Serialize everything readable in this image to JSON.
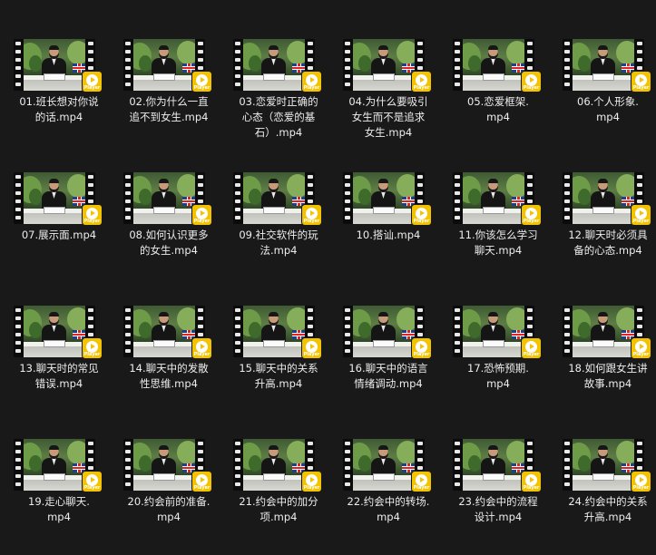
{
  "view": "file-grid",
  "thumbnail": {
    "type": "video-file",
    "badge_icon": "player-app-icon",
    "badge_text": "Player",
    "badge_color": "#f3c300"
  },
  "background_color": "#191919",
  "files": [
    {
      "name": "01.班长想对你说的话.mp4",
      "lines": [
        "01.班长想对你说",
        "的话.mp4"
      ]
    },
    {
      "name": "02.你为什么一直追不到女生.mp4",
      "lines": [
        "02.你为什么一直",
        "追不到女生.mp4"
      ]
    },
    {
      "name": "03.恋爱时正确的心态（恋爱的基石）.mp4",
      "lines": [
        "03.恋爱时正确的",
        "心态（恋爱的基",
        "石）.mp4"
      ]
    },
    {
      "name": "04.为什么要吸引女生而不是追求女生.mp4",
      "lines": [
        "04.为什么要吸引",
        "女生而不是追求",
        "女生.mp4"
      ]
    },
    {
      "name": "05.恋爱框架.mp4",
      "lines": [
        "05.恋爱框架.",
        "mp4"
      ]
    },
    {
      "name": "06.个人形象.mp4",
      "lines": [
        "06.个人形象.",
        "mp4"
      ]
    },
    {
      "name": "07.展示面.mp4",
      "lines": [
        "07.展示面.mp4"
      ]
    },
    {
      "name": "08.如何认识更多的女生.mp4",
      "lines": [
        "08.如何认识更多",
        "的女生.mp4"
      ]
    },
    {
      "name": "09.社交软件的玩法.mp4",
      "lines": [
        "09.社交软件的玩",
        "法.mp4"
      ]
    },
    {
      "name": "10.搭讪.mp4",
      "lines": [
        "10.搭讪.mp4"
      ]
    },
    {
      "name": "11.你该怎么学习聊天.mp4",
      "lines": [
        "11.你该怎么学习",
        "聊天.mp4"
      ]
    },
    {
      "name": "12.聊天时必须具备的心态.mp4",
      "lines": [
        "12.聊天时必须具",
        "备的心态.mp4"
      ]
    },
    {
      "name": "13.聊天时的常见错误.mp4",
      "lines": [
        "13.聊天时的常见",
        "错误.mp4"
      ]
    },
    {
      "name": "14.聊天中的发散性思维.mp4",
      "lines": [
        "14.聊天中的发散",
        "性思维.mp4"
      ]
    },
    {
      "name": "15.聊天中的关系升高.mp4",
      "lines": [
        "15.聊天中的关系",
        "升高.mp4"
      ]
    },
    {
      "name": "16.聊天中的语言情绪调动.mp4",
      "lines": [
        "16.聊天中的语言",
        "情绪调动.mp4"
      ]
    },
    {
      "name": "17.恐怖预期.mp4",
      "lines": [
        "17.恐怖预期.",
        "mp4"
      ]
    },
    {
      "name": "18.如何跟女生讲故事.mp4",
      "lines": [
        "18.如何跟女生讲",
        "故事.mp4"
      ]
    },
    {
      "name": "19.走心聊天.mp4",
      "lines": [
        "19.走心聊天.",
        "mp4"
      ]
    },
    {
      "name": "20.约会前的准备.mp4",
      "lines": [
        "20.约会前的准备.",
        "mp4"
      ]
    },
    {
      "name": "21.约会中的加分项.mp4",
      "lines": [
        "21.约会中的加分",
        "项.mp4"
      ]
    },
    {
      "name": "22.约会中的转场.mp4",
      "lines": [
        "22.约会中的转场.",
        "mp4"
      ]
    },
    {
      "name": "23.约会中的流程设计.mp4",
      "lines": [
        "23.约会中的流程",
        "设计.mp4"
      ]
    },
    {
      "name": "24.约会中的关系升高.mp4",
      "lines": [
        "24.约会中的关系",
        "升高.mp4"
      ]
    }
  ]
}
